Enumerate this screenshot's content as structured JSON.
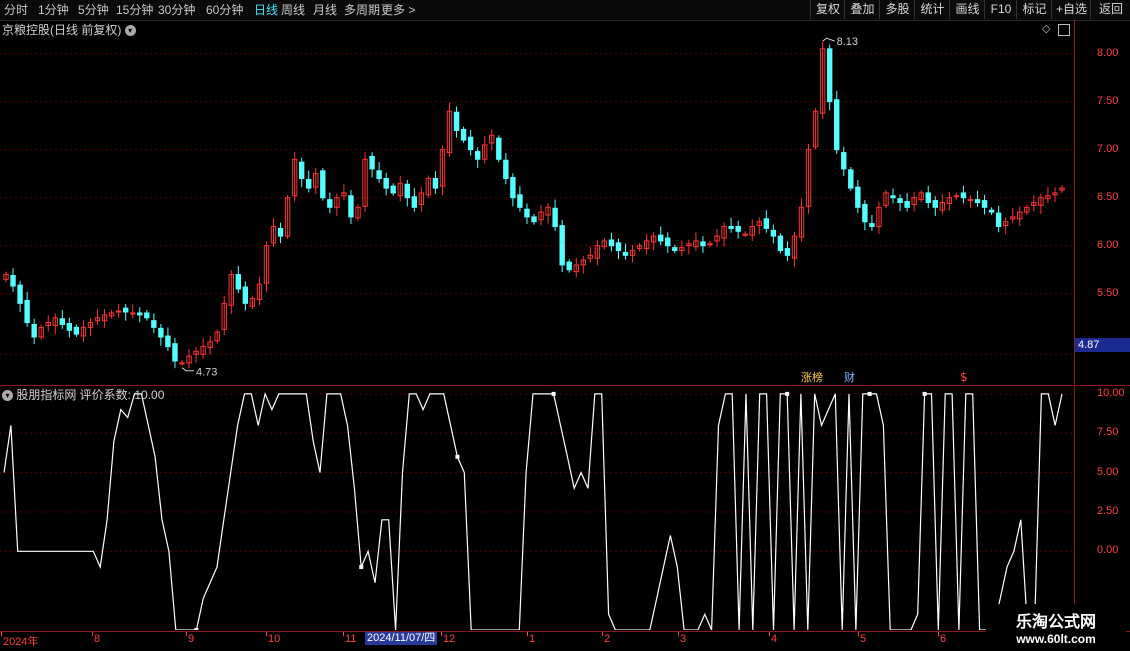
{
  "toolbar": {
    "tabs": [
      "分时",
      "1分钟",
      "5分钟",
      "15分钟",
      "30分钟",
      "60分钟",
      "日线",
      "周线",
      "月线",
      "多周期",
      "更多 >"
    ],
    "active_tab": "日线",
    "buttons": [
      "复权",
      "叠加",
      "多股",
      "统计",
      "画线",
      "F10",
      "标记",
      "+自选",
      "返回"
    ]
  },
  "main_chart": {
    "title": "京粮控股(日线 前复权)",
    "high_label": "8.13",
    "low_label": "4.73",
    "current_price": "4.87",
    "markers": {
      "zhangbang": "涨榜",
      "cai": "财",
      "dollar": "$"
    },
    "colors": {
      "up": "#ff3232",
      "down": "#54ffff",
      "grid": "#5a0000",
      "axis": "#ff4040"
    }
  },
  "sub_chart": {
    "title": "股朋指标网 评价系数: 10.00"
  },
  "time_axis": {
    "badge": "2024/11/07/四"
  },
  "watermark": {
    "line1": "乐淘公式网",
    "line2": "www.60lt.com"
  },
  "chart_data": [
    {
      "type": "candlestick",
      "title": "京粮控股(日线 前复权)",
      "y_ticks": [
        "8.00",
        "7.50",
        "7.00",
        "6.50",
        "6.00",
        "5.50"
      ],
      "ylim": [
        4.55,
        8.35
      ],
      "x_ticks": [
        "2024年",
        "8",
        "9",
        "10",
        "11",
        "12",
        "1",
        "2",
        "3",
        "4",
        "5",
        "6"
      ],
      "close": [
        5.7,
        5.58,
        5.4,
        5.2,
        5.05,
        5.15,
        5.2,
        5.25,
        5.18,
        5.12,
        5.08,
        5.15,
        5.2,
        5.25,
        5.28,
        5.3,
        5.32,
        5.31,
        5.3,
        5.28,
        5.25,
        5.15,
        5.05,
        4.95,
        4.8,
        4.78,
        4.85,
        4.9,
        4.95,
        5.0,
        5.1,
        5.4,
        5.7,
        5.55,
        5.4,
        5.45,
        5.6,
        6.0,
        6.2,
        6.1,
        6.5,
        6.9,
        6.7,
        6.6,
        6.75,
        6.5,
        6.4,
        6.5,
        6.55,
        6.3,
        6.4,
        6.9,
        6.8,
        6.7,
        6.6,
        6.55,
        6.65,
        6.5,
        6.4,
        6.55,
        6.7,
        6.6,
        7.0,
        7.4,
        7.2,
        7.1,
        7.0,
        6.9,
        7.05,
        7.15,
        6.9,
        6.7,
        6.5,
        6.4,
        6.3,
        6.25,
        6.35,
        6.4,
        6.2,
        5.8,
        5.75,
        5.8,
        5.85,
        5.9,
        6.0,
        6.05,
        6.0,
        5.95,
        5.9,
        5.95,
        6.0,
        6.05,
        6.1,
        6.05,
        6.0,
        5.95,
        5.98,
        6.02,
        6.05,
        6.0,
        6.02,
        6.1,
        6.2,
        6.18,
        6.15,
        6.12,
        6.2,
        6.25,
        6.18,
        6.1,
        5.95,
        5.9,
        6.1,
        6.4,
        7.0,
        7.4,
        8.05,
        7.5,
        7.0,
        6.8,
        6.6,
        6.4,
        6.25,
        6.2,
        6.4,
        6.55,
        6.5,
        6.45,
        6.4,
        6.5,
        6.55,
        6.45,
        6.4,
        6.45,
        6.5,
        6.52,
        6.5,
        6.48,
        6.45,
        6.4,
        6.35,
        6.2,
        6.25,
        6.3,
        6.35,
        6.4,
        6.45,
        6.5,
        6.52,
        6.55,
        6.6
      ],
      "notes": "approximate daily closes read from gridlines"
    },
    {
      "type": "line",
      "title": "股朋指标网 评价系数: 10.00",
      "y_ticks": [
        "10.00",
        "7.50",
        "5.00",
        "2.50",
        "0.00"
      ],
      "ylim": [
        -5.0,
        10.5
      ],
      "values": [
        5.0,
        8.0,
        0.0,
        0.0,
        0.0,
        0.0,
        0.0,
        0.0,
        0.0,
        0.0,
        0.0,
        0.0,
        0.0,
        0.0,
        -1.0,
        2.0,
        7.0,
        9.0,
        8.5,
        10.0,
        10.0,
        8.0,
        6.0,
        2.0,
        0.0,
        -5.0,
        -5.0,
        -5.0,
        -5.0,
        -3.0,
        -2.0,
        -1.0,
        2.0,
        5.0,
        8.0,
        10.0,
        10.0,
        8.0,
        10.0,
        9.0,
        10.0,
        10.0,
        10.0,
        10.0,
        10.0,
        7.0,
        5.0,
        10.0,
        10.0,
        10.0,
        8.0,
        4.0,
        -1.0,
        0.0,
        -2.0,
        2.0,
        2.0,
        -5.0,
        5.0,
        10.0,
        10.0,
        9.0,
        10.0,
        10.0,
        10.0,
        8.0,
        6.0,
        5.0,
        -5.0,
        -5.0,
        -5.0,
        -5.0,
        -5.0,
        -5.0,
        -5.0,
        -5.0,
        5.0,
        10.0,
        10.0,
        10.0,
        10.0,
        8.0,
        6.0,
        4.0,
        5.0,
        4.0,
        10.0,
        10.0,
        -4.0,
        -5.0,
        -5.0,
        -5.0,
        -5.0,
        -5.0,
        -5.0,
        -3.0,
        -1.0,
        1.0,
        -1.0,
        -5.0,
        -5.0,
        -5.0,
        -4.0,
        -5.0,
        8.0,
        10.0,
        10.0,
        -5.0,
        10.0,
        -5.0,
        10.0,
        10.0,
        -5.0,
        10.0,
        10.0,
        -5.0,
        10.0,
        -5.0,
        10.0,
        8.0,
        9.0,
        10.0,
        -5.0,
        10.0,
        -5.0,
        10.0,
        10.0,
        10.0,
        8.0,
        -5.0,
        -5.0,
        -5.0,
        -5.0,
        -4.0,
        10.0,
        10.0,
        -5.0,
        10.0,
        10.0,
        -5.0,
        10.0,
        10.0,
        -5.0,
        -5.0,
        -5.0,
        -3.0,
        -1.0,
        0.0,
        2.0,
        -5.0,
        -5.0,
        10.0,
        10.0,
        8.0,
        10.0
      ]
    }
  ]
}
